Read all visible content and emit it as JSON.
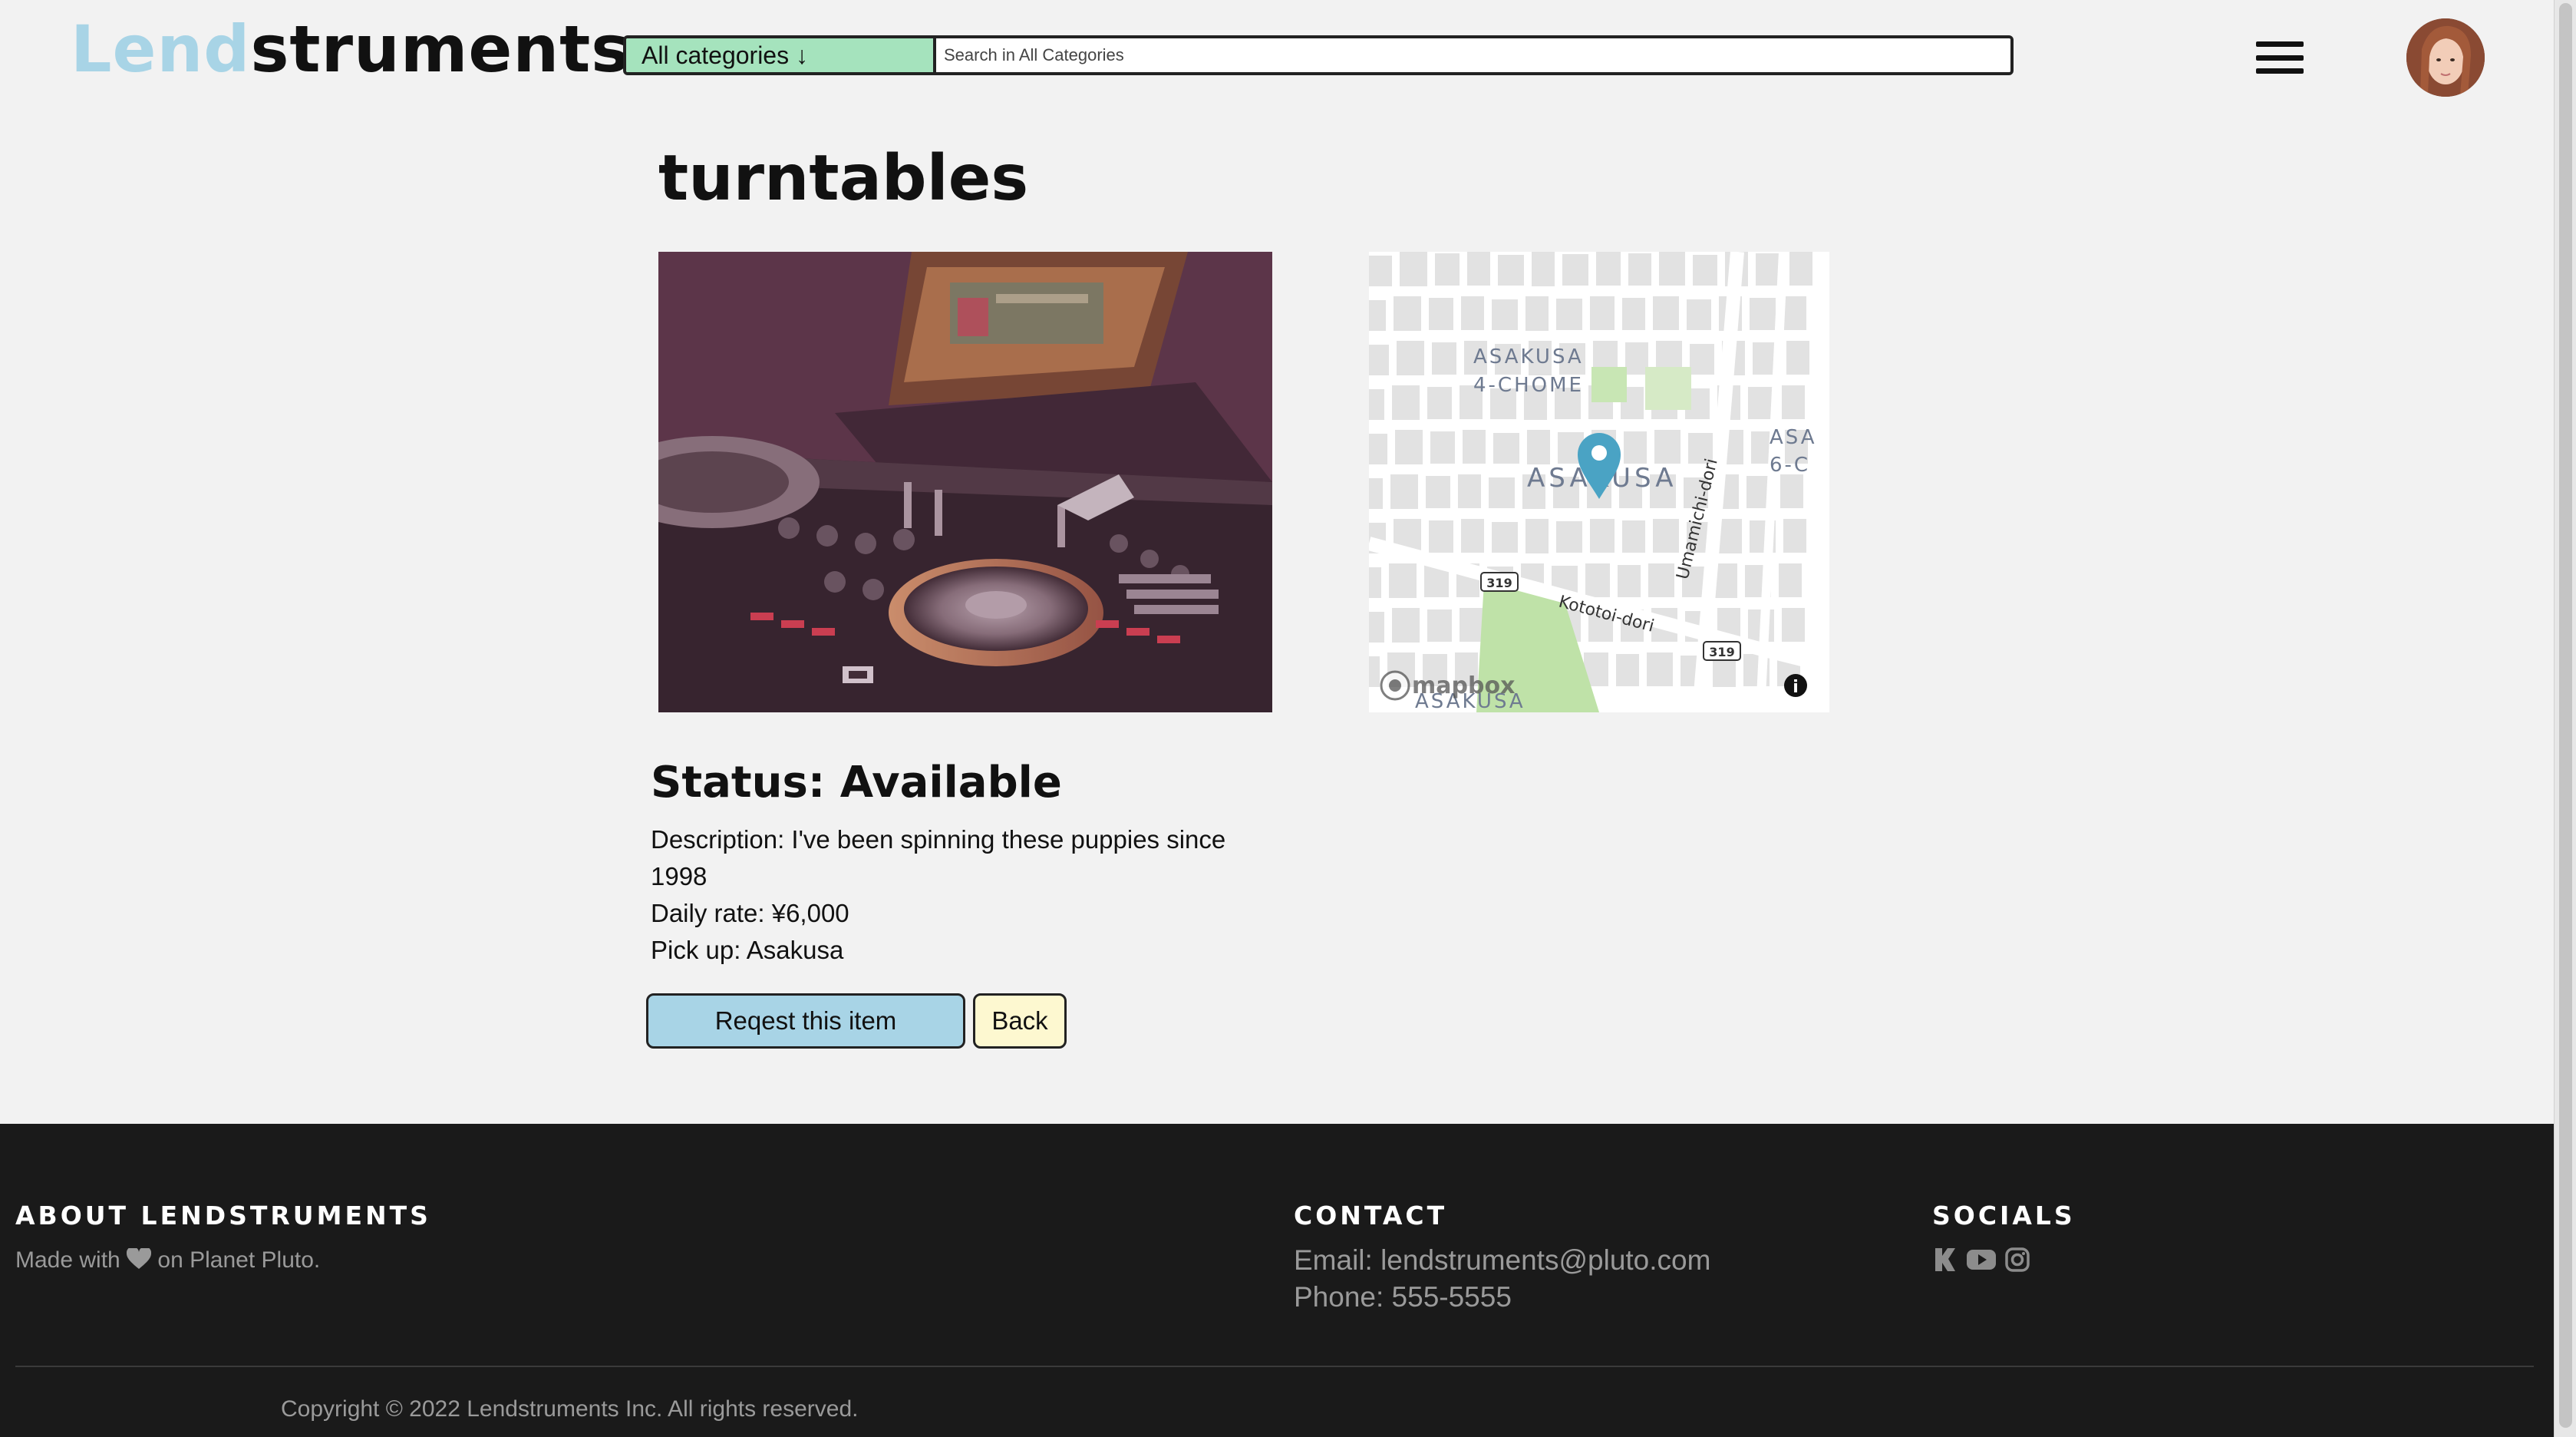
{
  "header": {
    "logo_part1": "Lend",
    "logo_part2": "struments",
    "category_select": "All categories ↓",
    "search_placeholder": "Search in All Categories",
    "brand_color": "#a8d4e6",
    "category_color": "#a5e3bd"
  },
  "item": {
    "title": "turntables",
    "status": "Status: Available",
    "description": "Description: I've been spinning these puppies since 1998",
    "daily_rate": "Daily rate: ¥6,000",
    "pick_up": "Pick up: Asakusa"
  },
  "map": {
    "labels": {
      "district_a1": "ASAKUSA",
      "district_a2": "4-CHOME",
      "district_main": "ASAKUSA",
      "district_b1": "ASA",
      "district_b2": "6-C",
      "district_bottom": "ASAKUSA",
      "street1": "Umamichi-dori",
      "street2": "Kototoi-dori",
      "route1": "319",
      "route2": "319",
      "attribution": "mapbox",
      "info": "i"
    }
  },
  "actions": {
    "request_label": "Reqest this item",
    "back_label": "Back",
    "request_color": "#a8d4e6",
    "back_color": "#fdf8d0"
  },
  "footer": {
    "about_heading": "ABOUT LENDSTRUMENTS",
    "about_text_pre": "Made with",
    "about_text_post": "on Planet Pluto.",
    "contact_heading": "CONTACT",
    "email": "Email: lendstruments@pluto.com",
    "phone": "Phone: 555-5555",
    "socials_heading": "SOCIALS",
    "socials": [
      "kickstarter-icon",
      "youtube-icon",
      "instagram-icon"
    ],
    "copyright": "Copyright © 2022 Lendstruments Inc. All rights reserved."
  }
}
